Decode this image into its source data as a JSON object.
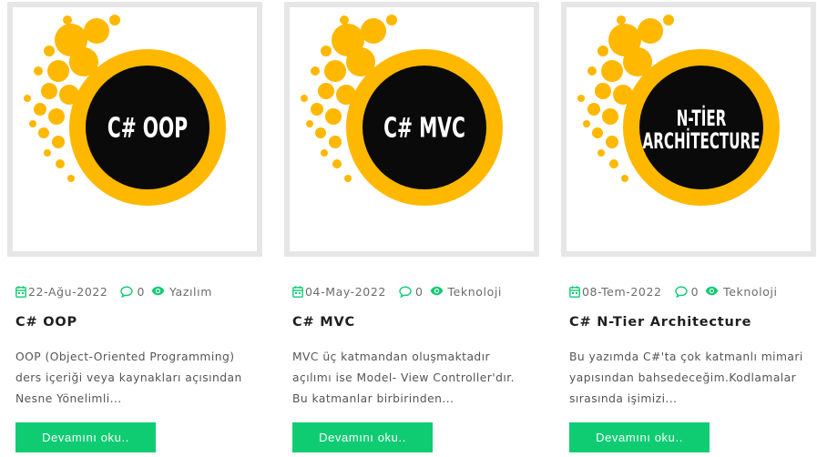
{
  "colors": {
    "accent": "#0fcc72",
    "logo_yellow": "#ffb800",
    "logo_black": "#0a0a0a",
    "frame": "#e6e6e6"
  },
  "posts": [
    {
      "image_text": [
        "C# OOP"
      ],
      "date": "22-Ağu-2022",
      "comments": "0",
      "category": "Yazılım",
      "title": "C# OOP",
      "excerpt": [
        "OOP (Object-Oriented Programming)",
        "ders içeriği veya kaynakları açısından",
        "Nesne Yönelimli..."
      ],
      "button": "Devamını oku.."
    },
    {
      "image_text": [
        "C# MVC"
      ],
      "date": "04-May-2022",
      "comments": "0",
      "category": "Teknoloji",
      "title": "C# MVC",
      "excerpt": [
        "MVC üç katmandan oluşmaktadır",
        "açılımı ise Model- View Controller'dır.",
        "Bu katmanlar birbirinden..."
      ],
      "button": "Devamını oku.."
    },
    {
      "image_text": [
        "N-TİER",
        "ARCHİTECTURE"
      ],
      "date": "08-Tem-2022",
      "comments": "0",
      "category": "Teknoloji",
      "title": "C# N-Tier Architecture",
      "excerpt": [
        "Bu yazımda C#'ta çok katmanlı mimari",
        "yapısından bahsedeceğim.Kodlamalar",
        "sırasında işimizi..."
      ],
      "button": "Devamını oku.."
    }
  ],
  "icons": [
    "calendar-icon",
    "comment-icon",
    "eye-icon"
  ]
}
